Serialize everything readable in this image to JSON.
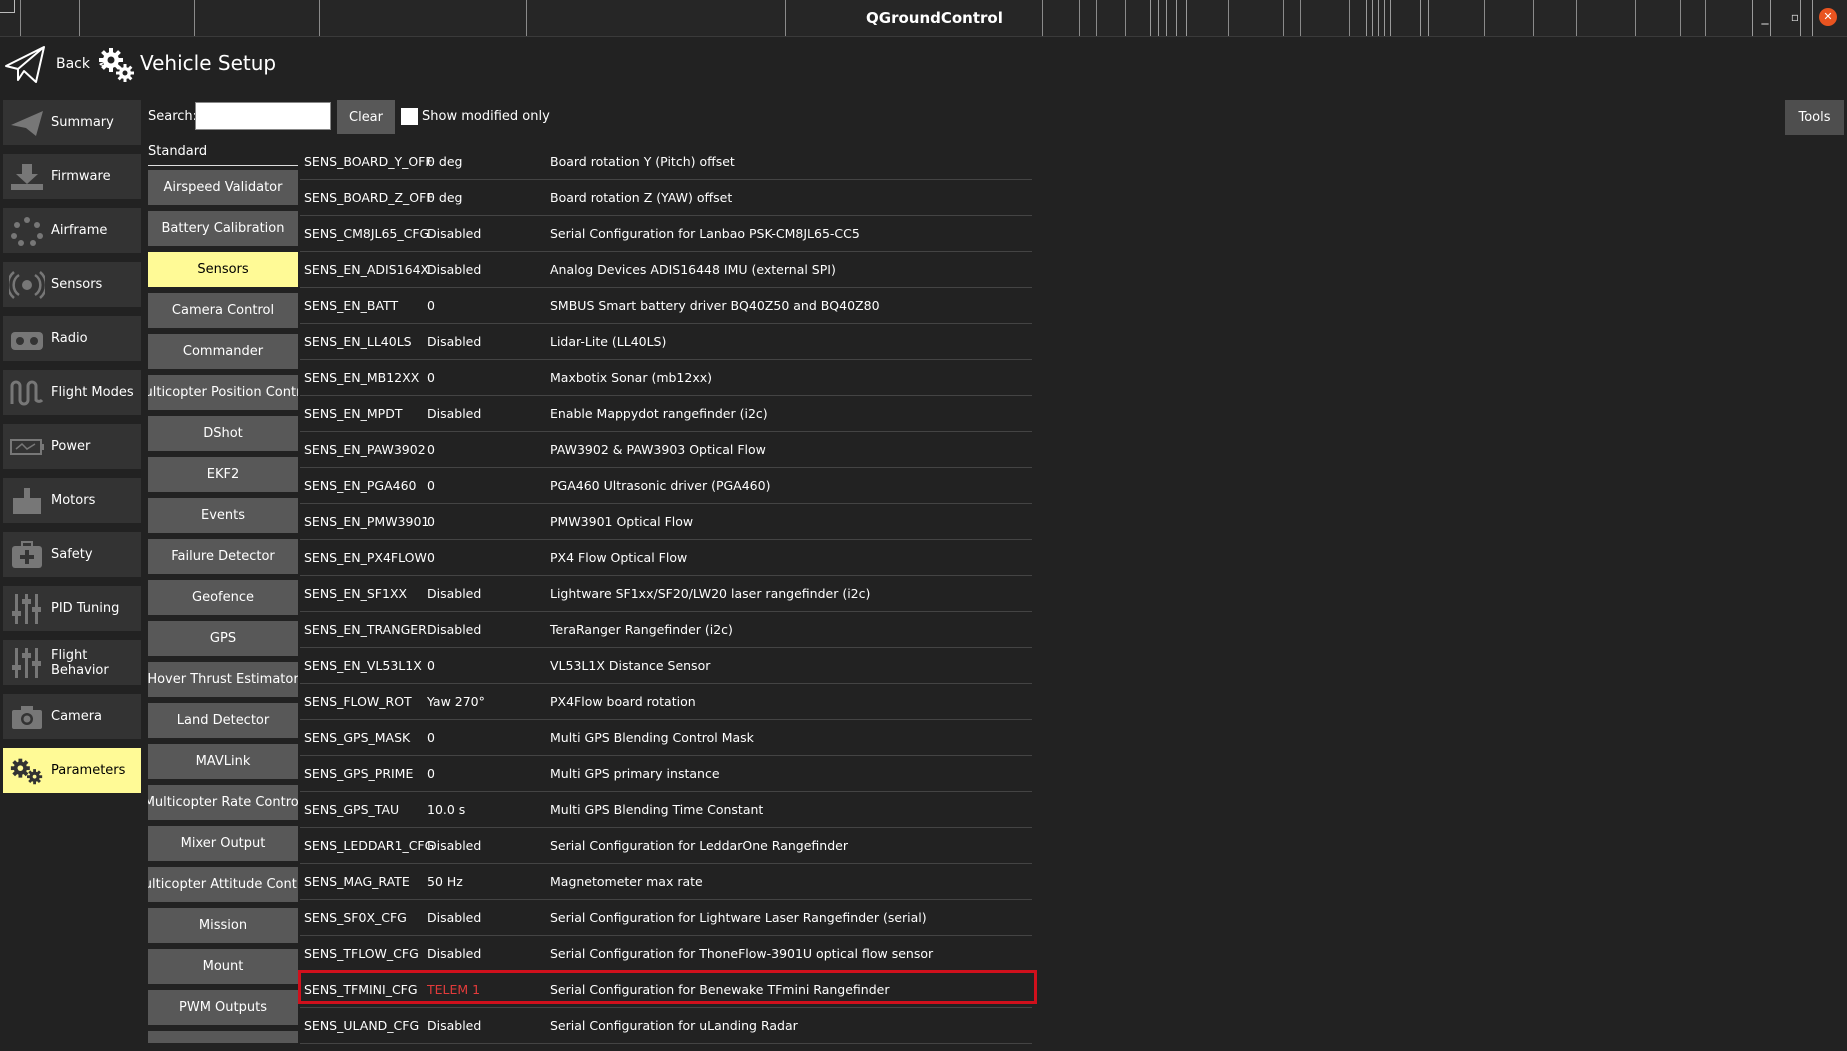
{
  "window": {
    "title": "QGroundControl",
    "min_glyph": "_",
    "max_glyph": "▫",
    "close_glyph": "✕"
  },
  "header": {
    "back_label": "Back",
    "separator": "<",
    "title": "Vehicle Setup"
  },
  "sidebar": {
    "items": [
      {
        "label": "Summary",
        "icon": "paper-plane-icon"
      },
      {
        "label": "Firmware",
        "icon": "download-icon"
      },
      {
        "label": "Airframe",
        "icon": "airframe-icon"
      },
      {
        "label": "Sensors",
        "icon": "sensor-icon"
      },
      {
        "label": "Radio",
        "icon": "radio-controller-icon"
      },
      {
        "label": "Flight Modes",
        "icon": "waves-icon"
      },
      {
        "label": "Power",
        "icon": "battery-icon"
      },
      {
        "label": "Motors",
        "icon": "motor-icon"
      },
      {
        "label": "Safety",
        "icon": "first-aid-icon"
      },
      {
        "label": "PID Tuning",
        "icon": "sliders-icon"
      },
      {
        "label": "Flight Behavior",
        "icon": "sliders-icon"
      },
      {
        "label": "Camera",
        "icon": "camera-icon"
      },
      {
        "label": "Parameters",
        "icon": "gears-icon",
        "active": true
      }
    ]
  },
  "search": {
    "label": "Search:",
    "value": "",
    "clear_label": "Clear",
    "modified_only_label": "Show modified only"
  },
  "tools_label": "Tools",
  "groups": {
    "header": "Standard",
    "items": [
      "Airspeed Validator",
      "Battery Calibration",
      "Sensors",
      "Camera Control",
      "Commander",
      "Multicopter Position Control",
      "DShot",
      "EKF2",
      "Events",
      "Failure Detector",
      "Geofence",
      "GPS",
      "Hover Thrust Estimator",
      "Land Detector",
      "MAVLink",
      "Multicopter Rate Control",
      "Mixer Output",
      "Multicopter Attitude Control",
      "Mission",
      "Mount",
      "PWM Outputs"
    ],
    "active": "Sensors"
  },
  "params": [
    {
      "name": "SENS_BOARD_Y_OFF",
      "value": "0 deg",
      "desc": "Board rotation Y (Pitch) offset"
    },
    {
      "name": "SENS_BOARD_Z_OFF",
      "value": "0 deg",
      "desc": "Board rotation Z (YAW) offset"
    },
    {
      "name": "SENS_CM8JL65_CFG",
      "value": "Disabled",
      "desc": "Serial Configuration for Lanbao PSK-CM8JL65-CC5"
    },
    {
      "name": "SENS_EN_ADIS164X",
      "value": "Disabled",
      "desc": "Analog Devices ADIS16448 IMU (external SPI)"
    },
    {
      "name": "SENS_EN_BATT",
      "value": "0",
      "desc": "SMBUS Smart battery driver BQ40Z50 and BQ40Z80"
    },
    {
      "name": "SENS_EN_LL40LS",
      "value": "Disabled",
      "desc": "Lidar-Lite (LL40LS)"
    },
    {
      "name": "SENS_EN_MB12XX",
      "value": "0",
      "desc": "Maxbotix Sonar (mb12xx)"
    },
    {
      "name": "SENS_EN_MPDT",
      "value": "Disabled",
      "desc": "Enable Mappydot rangefinder (i2c)"
    },
    {
      "name": "SENS_EN_PAW3902",
      "value": "0",
      "desc": "PAW3902 & PAW3903 Optical Flow"
    },
    {
      "name": "SENS_EN_PGA460",
      "value": "0",
      "desc": "PGA460 Ultrasonic driver (PGA460)"
    },
    {
      "name": "SENS_EN_PMW3901",
      "value": "0",
      "desc": "PMW3901 Optical Flow"
    },
    {
      "name": "SENS_EN_PX4FLOW",
      "value": "0",
      "desc": "PX4 Flow Optical Flow"
    },
    {
      "name": "SENS_EN_SF1XX",
      "value": "Disabled",
      "desc": "Lightware SF1xx/SF20/LW20 laser rangefinder (i2c)"
    },
    {
      "name": "SENS_EN_TRANGER",
      "value": "Disabled",
      "desc": "TeraRanger Rangefinder (i2c)"
    },
    {
      "name": "SENS_EN_VL53L1X",
      "value": "0",
      "desc": "VL53L1X Distance Sensor"
    },
    {
      "name": "SENS_FLOW_ROT",
      "value": "Yaw 270°",
      "desc": "PX4Flow board rotation"
    },
    {
      "name": "SENS_GPS_MASK",
      "value": "0",
      "desc": "Multi GPS Blending Control Mask"
    },
    {
      "name": "SENS_GPS_PRIME",
      "value": "0",
      "desc": "Multi GPS primary instance"
    },
    {
      "name": "SENS_GPS_TAU",
      "value": "10.0 s",
      "desc": "Multi GPS Blending Time Constant"
    },
    {
      "name": "SENS_LEDDAR1_CFG",
      "value": "Disabled",
      "desc": "Serial Configuration for LeddarOne Rangefinder"
    },
    {
      "name": "SENS_MAG_RATE",
      "value": "50 Hz",
      "desc": "Magnetometer max rate"
    },
    {
      "name": "SENS_SF0X_CFG",
      "value": "Disabled",
      "desc": "Serial Configuration for Lightware Laser Rangefinder (serial)"
    },
    {
      "name": "SENS_TFLOW_CFG",
      "value": "Disabled",
      "desc": "Serial Configuration for ThoneFlow-3901U optical flow sensor"
    },
    {
      "name": "SENS_TFMINI_CFG",
      "value": "TELEM 1",
      "desc": "Serial Configuration for Benewake TFmini Rangefinder",
      "highlighted": true
    },
    {
      "name": "SENS_ULAND_CFG",
      "value": "Disabled",
      "desc": "Serial Configuration for uLanding Radar"
    }
  ],
  "colors": {
    "active_bg": "#fffa96",
    "highlight_border": "#d0101c",
    "highlight_value": "#e23b3b",
    "close_button": "#e95420"
  }
}
